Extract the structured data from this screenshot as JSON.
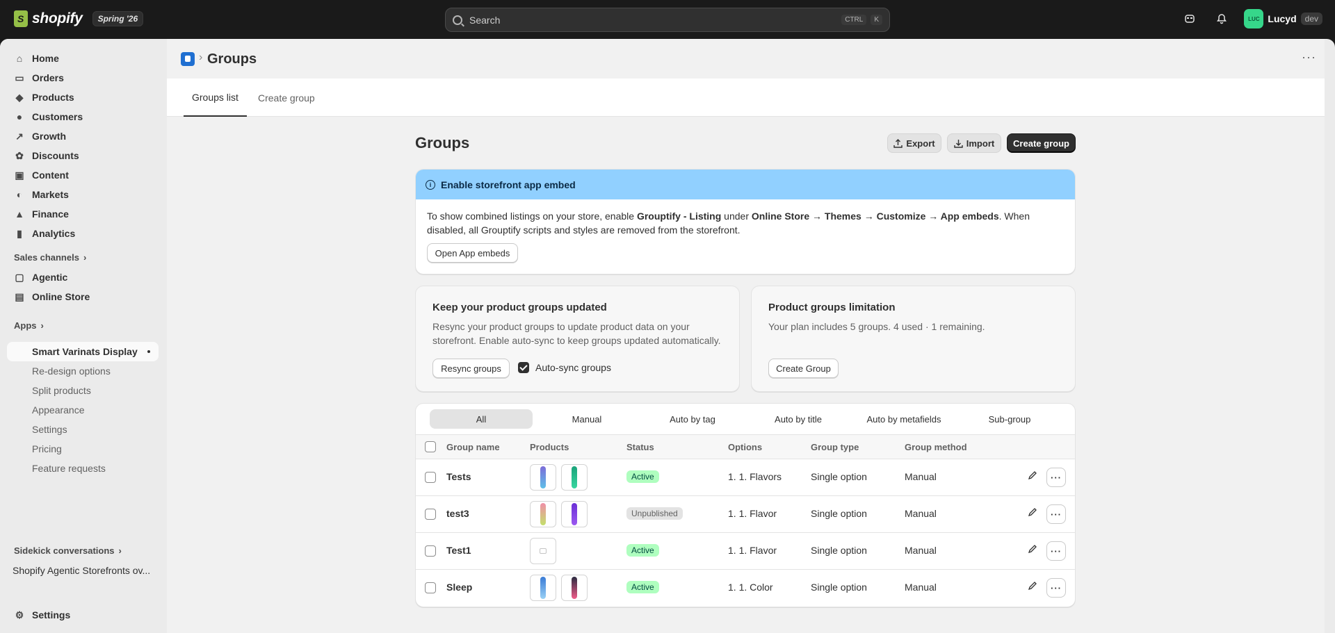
{
  "topbar": {
    "brand": "shopify",
    "edition": "Spring '26",
    "search_placeholder": "Search",
    "shortcut_ctrl": "CTRL",
    "shortcut_key": "K",
    "user_initials": "LUC",
    "user_name": "Lucyd",
    "env_badge": "dev"
  },
  "sidebar": {
    "items": [
      {
        "label": "Home",
        "icon": "home-icon"
      },
      {
        "label": "Orders",
        "icon": "inbox-icon"
      },
      {
        "label": "Products",
        "icon": "tag-icon"
      },
      {
        "label": "Customers",
        "icon": "person-icon"
      },
      {
        "label": "Growth",
        "icon": "growth-icon"
      },
      {
        "label": "Discounts",
        "icon": "discount-icon"
      },
      {
        "label": "Content",
        "icon": "content-icon"
      },
      {
        "label": "Markets",
        "icon": "globe-icon"
      },
      {
        "label": "Finance",
        "icon": "bank-icon"
      },
      {
        "label": "Analytics",
        "icon": "bar-chart-icon"
      }
    ],
    "sales_channels_label": "Sales channels",
    "channels": [
      {
        "label": "Agentic",
        "icon": "agentic-icon"
      },
      {
        "label": "Online Store",
        "icon": "store-icon"
      }
    ],
    "apps_label": "Apps",
    "app_name": "Smart Varinats Display",
    "app_subitems": [
      "Re-design options",
      "Split products",
      "Appearance",
      "Settings",
      "Pricing",
      "Feature requests"
    ],
    "sidekick_label": "Sidekick conversations",
    "sidekick_item": "Shopify Agentic Storefronts ov...",
    "settings_label": "Settings"
  },
  "header": {
    "title": "Groups"
  },
  "tabs": [
    "Groups list",
    "Create group"
  ],
  "content": {
    "heading": "Groups",
    "export_label": "Export",
    "import_label": "Import",
    "create_group_label": "Create group"
  },
  "banner": {
    "title": "Enable storefront app embed",
    "text_1": "To show combined listings on your store, enable ",
    "text_bold_1": "Grouptify - Listing",
    "text_2": " under ",
    "text_bold_2": "Online Store → Themes → Customize → App embeds",
    "text_3": ". When disabled, all Grouptify scripts and styles are removed from the storefront.",
    "button_label": "Open App embeds"
  },
  "sync_card": {
    "title": "Keep your product groups updated",
    "text": "Resync your product groups to update product data on your storefront. Enable auto-sync to keep groups updated automatically.",
    "button_label": "Resync groups",
    "checkbox_label": "Auto-sync groups",
    "checkbox_checked": true
  },
  "limit_card": {
    "title": "Product groups limitation",
    "text": "Your plan includes 5 groups. 4 used · 1 remaining.",
    "button_label": "Create Group"
  },
  "filters": [
    "All",
    "Manual",
    "Auto by tag",
    "Auto by title",
    "Auto by metafields",
    "Sub-group"
  ],
  "table": {
    "columns": [
      "Group name",
      "Products",
      "Status",
      "Options",
      "Group type",
      "Group method"
    ],
    "rows": [
      {
        "name": "Tests",
        "status": "Active",
        "options": "1. 1. Flavors",
        "type": "Single option",
        "method": "Manual",
        "thumbs": [
          [
            "#7c6cd8",
            "#5fc0e8"
          ],
          [
            "#1aa37a",
            "#38d6a0"
          ]
        ]
      },
      {
        "name": "test3",
        "status": "Unpublished",
        "options": "1. 1. Flavor",
        "type": "Single option",
        "method": "Manual",
        "thumbs": [
          [
            "#f08fa8",
            "#c4e06c"
          ],
          [
            "#6a2fd6",
            "#9b59f0"
          ]
        ]
      },
      {
        "name": "Test1",
        "status": "Active",
        "options": "1. 1. Flavor",
        "type": "Single option",
        "method": "Manual",
        "thumbs": [
          [
            "placeholder"
          ]
        ]
      },
      {
        "name": "Sleep",
        "status": "Active",
        "options": "1. 1. Color",
        "type": "Single option",
        "method": "Manual",
        "thumbs": [
          [
            "#3a7bd5",
            "#9ad1f5"
          ],
          [
            "#2a2a40",
            "#f25c8a"
          ]
        ]
      }
    ]
  },
  "colors": {
    "active_badge": "#affebf",
    "banner": "#91d0ff",
    "primary_button": "#303030"
  }
}
